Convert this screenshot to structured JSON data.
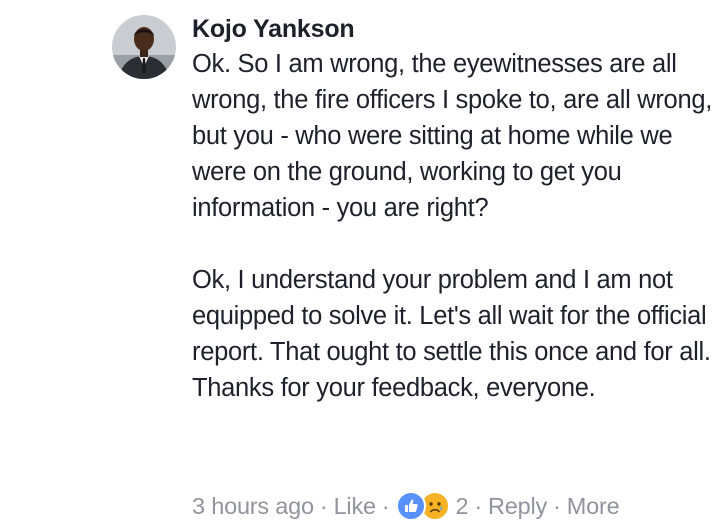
{
  "comment": {
    "author": "Kojo Yankson",
    "paragraphs": [
      "Ok. So I am wrong, the eyewitnesses are all wrong, the fire officers I spoke to, are all wrong, but you - who were sitting at home while we were on the ground, working to get you information - you are right?",
      "Ok, I understand your problem and I am not equipped to solve it. Let's all wait for the official report. That ought to settle this once and for all. Thanks for your feedback, everyone."
    ],
    "timestamp": "3 hours ago",
    "like_label": "Like",
    "reaction_count": "2",
    "reply_label": "Reply",
    "more_label": "More",
    "separator": "·",
    "reactions": [
      "like-reaction-icon",
      "sad-reaction-icon"
    ]
  },
  "colors": {
    "text": "#1d2129",
    "meta": "#90949c",
    "like_blue": "#5890ff",
    "sad_yellow": "#f7b125"
  }
}
